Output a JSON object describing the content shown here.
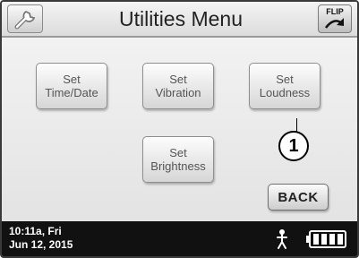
{
  "header": {
    "title": "Utilities Menu",
    "left_icon": "wrench-icon",
    "flip_label": "FLIP",
    "flip_icon": "curved-arrow-icon"
  },
  "buttons": {
    "set_time_date": {
      "line1": "Set",
      "line2": "Time/Date"
    },
    "set_vibration": {
      "line1": "Set",
      "line2": "Vibration"
    },
    "set_loudness": {
      "line1": "Set",
      "line2": "Loudness"
    },
    "set_brightness": {
      "line1": "Set",
      "line2": "Brightness"
    },
    "back": "BACK"
  },
  "callout": {
    "number": "1"
  },
  "status": {
    "time": "10:11a, Fri",
    "date": "Jun 12, 2015",
    "person_icon": "person-icon",
    "battery_icon": "battery-icon"
  },
  "colors": {
    "status_bar": "#111111",
    "screen_background": "#ececec"
  }
}
